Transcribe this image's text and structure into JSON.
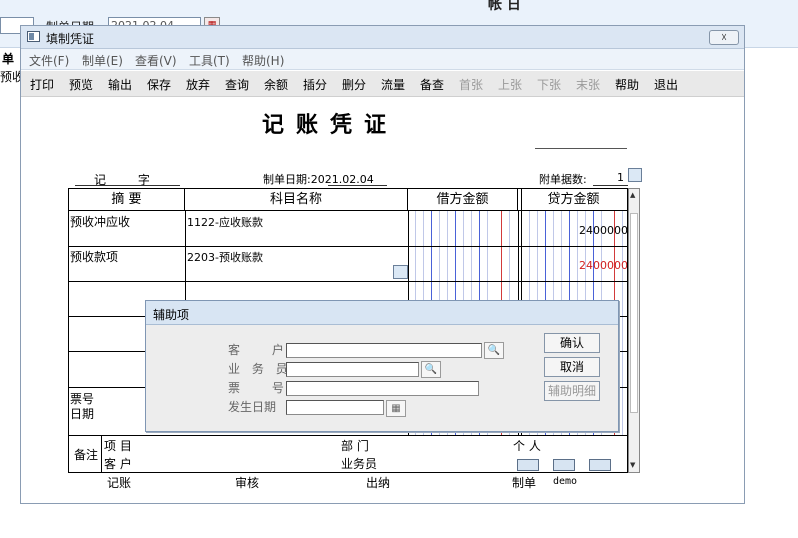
{
  "background": {
    "date_label": "制单日期",
    "date_value": "2021.02.04",
    "top_right_text": "帐 日",
    "left_text_1": "单",
    "left_text_2": "预收"
  },
  "window": {
    "title": "填制凭证",
    "close_label": "☓"
  },
  "menu": [
    "文件(F)",
    "制单(E)",
    "查看(V)",
    "工具(T)",
    "帮助(H)"
  ],
  "toolbar": [
    {
      "label": "打印",
      "enabled": true
    },
    {
      "label": "预览",
      "enabled": true
    },
    {
      "label": "输出",
      "enabled": true
    },
    {
      "label": "保存",
      "enabled": true
    },
    {
      "label": "放弃",
      "enabled": true
    },
    {
      "label": "查询",
      "enabled": true
    },
    {
      "label": "余额",
      "enabled": true
    },
    {
      "label": "插分",
      "enabled": true
    },
    {
      "label": "删分",
      "enabled": true
    },
    {
      "label": "流量",
      "enabled": true
    },
    {
      "label": "备查",
      "enabled": true
    },
    {
      "label": "首张",
      "enabled": false
    },
    {
      "label": "上张",
      "enabled": false
    },
    {
      "label": "下张",
      "enabled": false
    },
    {
      "label": "末张",
      "enabled": false
    },
    {
      "label": "帮助",
      "enabled": true
    },
    {
      "label": "退出",
      "enabled": true
    }
  ],
  "voucher": {
    "title": "记账凭证",
    "type_label": "记 字",
    "date_label": "制单日期:",
    "date_value": "2021.02.04",
    "attach_label": "附单据数:",
    "attach_value": "1",
    "columns": [
      "摘 要",
      "科目名称",
      "借方金额",
      "贷方金额"
    ],
    "rows": [
      {
        "summary": "预收冲应收",
        "account": "1122-应收账款",
        "debit": "",
        "credit": "2400000",
        "credit_color": "#000000"
      },
      {
        "summary": "预收款项",
        "account": "2203-预收账款",
        "debit": "",
        "credit": "2400000",
        "credit_color": "#d21f1f"
      }
    ],
    "ticket_no_label": "票号",
    "ticket_date_label": "日期",
    "remark_label": "备注",
    "project_label": "项 目",
    "customer_label": "客 户",
    "dept_label": "部 门",
    "salesman_label": "业务员",
    "person_label": "个 人",
    "footer": {
      "bookkeeping": "记账",
      "audit": "审核",
      "cashier": "出纳",
      "maker": "制单",
      "maker_value": "demo"
    }
  },
  "dialog": {
    "title": "辅助项",
    "fields": [
      {
        "label": "客 户",
        "value": ""
      },
      {
        "label": "业 务 员",
        "value": ""
      },
      {
        "label": "票 号",
        "value": ""
      },
      {
        "label": "发生日期",
        "value": ""
      }
    ],
    "confirm": "确认",
    "cancel": "取消",
    "aux_detail": "辅助明细"
  },
  "colors": {
    "accent": "#dbe6f3",
    "credit_red": "#d21f1f",
    "grid_blue": "#4a62d8"
  }
}
